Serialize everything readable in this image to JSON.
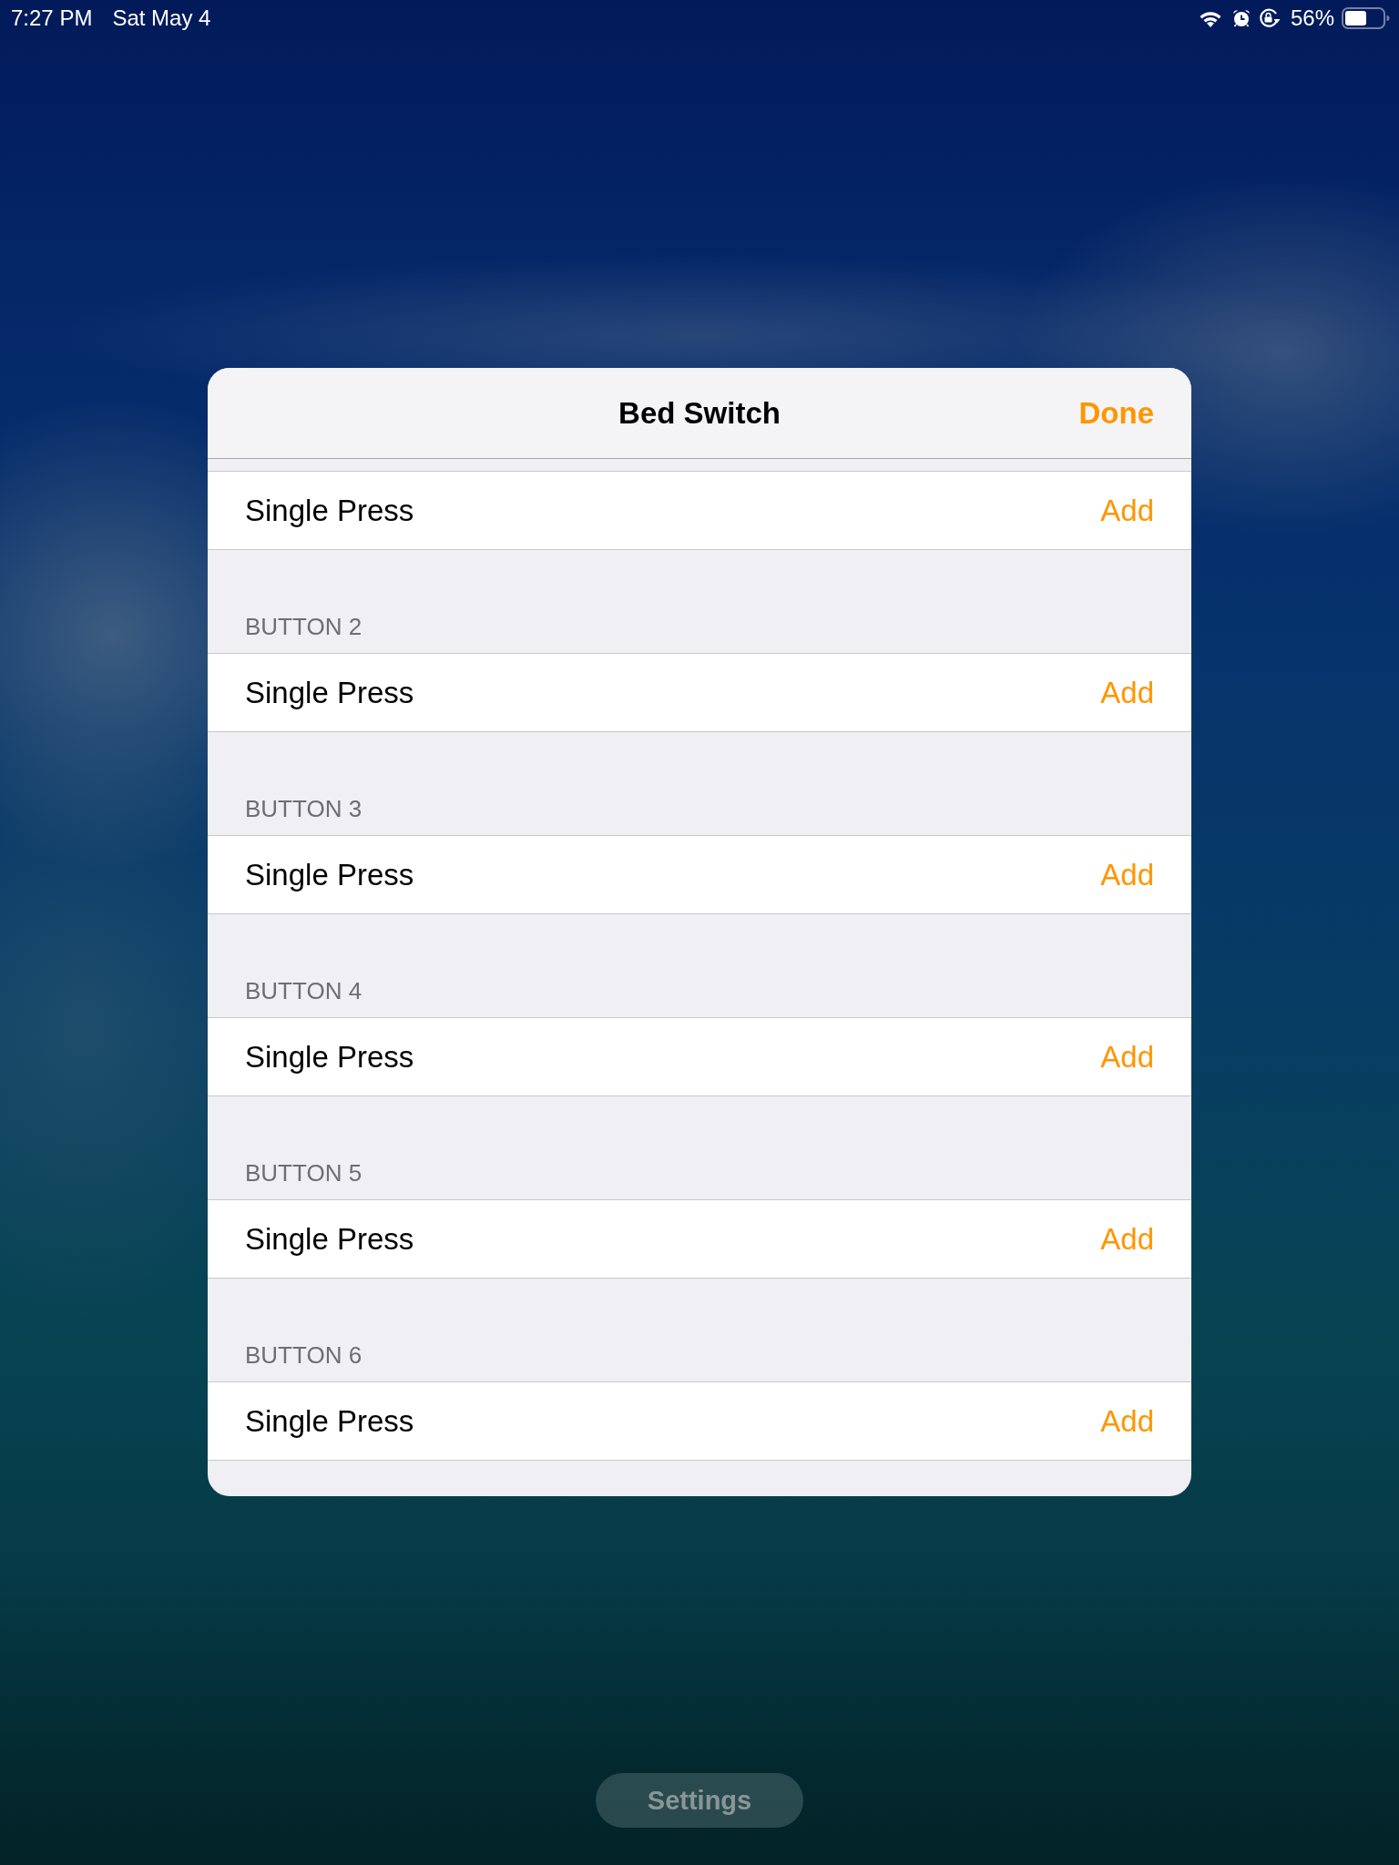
{
  "status_bar": {
    "time": "7:27 PM",
    "date": "Sat May 4",
    "battery_text": "56%"
  },
  "sheet": {
    "title": "Bed Switch",
    "done": "Done",
    "sections": [
      {
        "rows": [
          {
            "label": "Single Press",
            "action": "Add"
          }
        ]
      },
      {
        "header": "BUTTON 2",
        "rows": [
          {
            "label": "Single Press",
            "action": "Add"
          }
        ]
      },
      {
        "header": "BUTTON 3",
        "rows": [
          {
            "label": "Single Press",
            "action": "Add"
          }
        ]
      },
      {
        "header": "BUTTON 4",
        "rows": [
          {
            "label": "Single Press",
            "action": "Add"
          }
        ]
      },
      {
        "header": "BUTTON 5",
        "rows": [
          {
            "label": "Single Press",
            "action": "Add"
          }
        ]
      },
      {
        "header": "BUTTON 6",
        "rows": [
          {
            "label": "Single Press",
            "action": "Add"
          }
        ]
      }
    ]
  },
  "bottom_button": "Settings"
}
